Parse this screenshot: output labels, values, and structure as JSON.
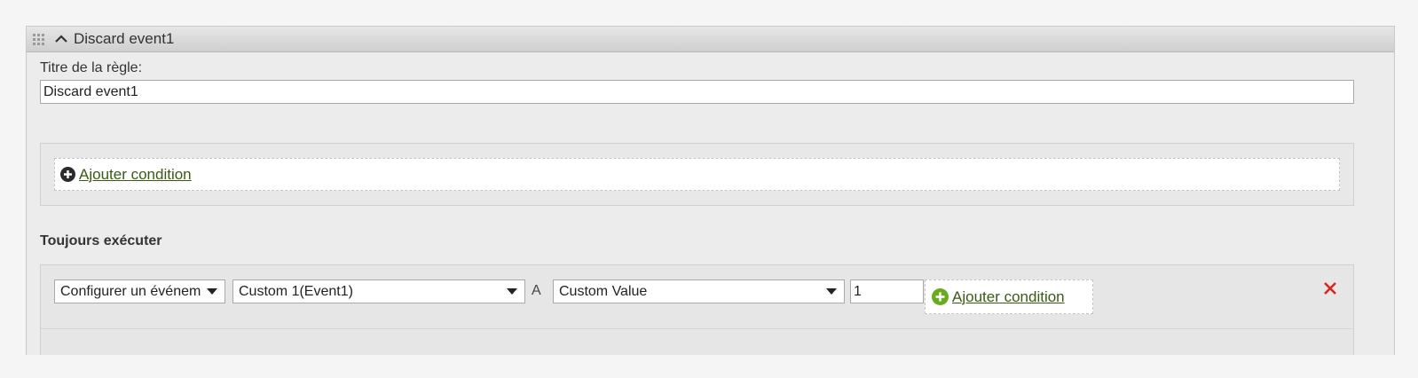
{
  "panel": {
    "title": "Discard event1"
  },
  "rule_title": {
    "label": "Titre de la règle:",
    "value": "Discard event1"
  },
  "conditions": {
    "add_label": "Ajouter condition"
  },
  "always_execute": {
    "title": "Toujours exécuter",
    "action_select": "Configurer un événem",
    "target_select": "Custom 1(Event1)",
    "connector": "A",
    "value_type_select": "Custom Value",
    "value": "1",
    "add_label": "Ajouter condition"
  },
  "colors": {
    "link": "#3a5a14",
    "plus_green": "#6aaa1e",
    "close_red": "#d9261c"
  },
  "icons": [
    "grip-icon",
    "chevron-up-icon",
    "plus-circle-icon",
    "plus-circle-green-icon",
    "close-icon"
  ]
}
